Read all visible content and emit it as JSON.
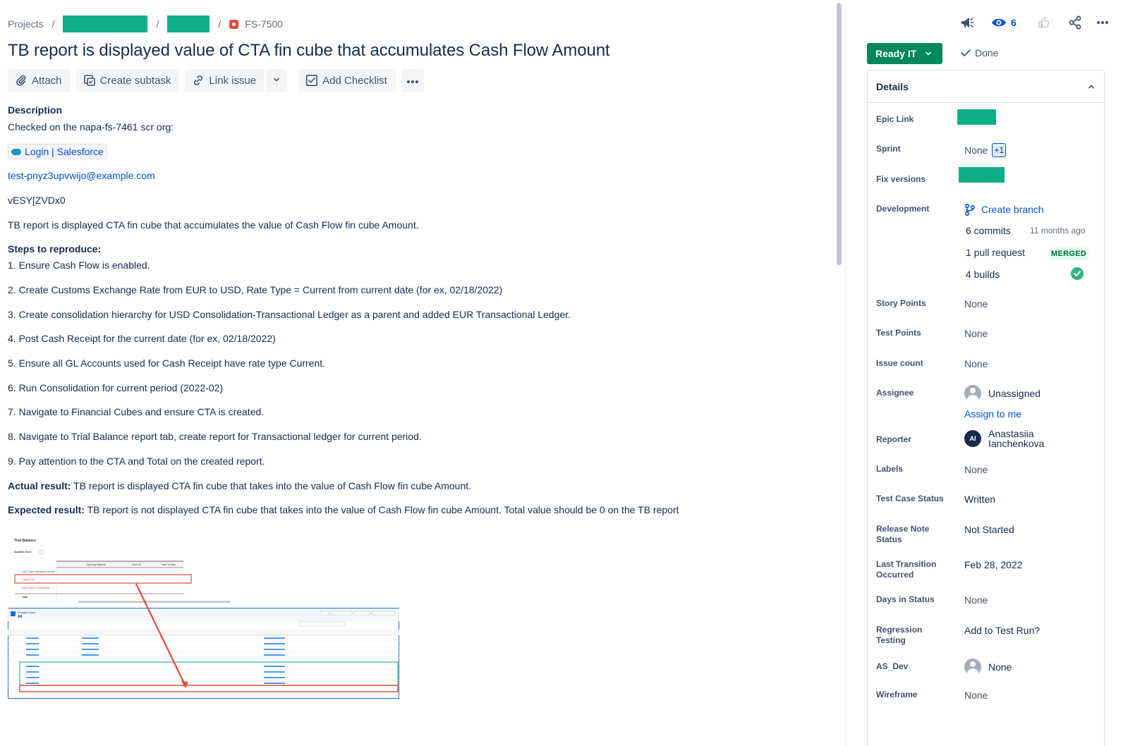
{
  "breadcrumb": {
    "projects": "Projects",
    "sep": "/",
    "issue_key": "FS-7500"
  },
  "issue": {
    "title": "TB report is displayed value of CTA fin cube that accumulates Cash Flow Amount"
  },
  "toolbar": {
    "attach": "Attach",
    "create_subtask": "Create subtask",
    "link_issue": "Link issue",
    "add_checklist": "Add Checklist"
  },
  "description": {
    "heading": "Description",
    "checked_on": "Checked on the napa-fs-7461 scr org:",
    "login_link": "Login | Salesforce",
    "email": "test-pnyz3upvwijo@example.com",
    "password": "vESY[ZVDx0",
    "summary": "TB report is displayed CTA fin cube that accumulates the value of Cash Flow fin cube Amount.",
    "steps_heading": "Steps to reproduce:",
    "steps": [
      "1.  Ensure Cash Flow is enabled.",
      "2. Create Customs Exchange Rate from EUR to USD, Rate Type = Current from current date (for ex, 02/18/2022)",
      "3.  Create consolidation hierarchy for USD Consolidation-Transactional Ledger as a parent and added EUR Transactional Ledger.",
      "4.  Post Cash Receipt for the current date (for ex, 02/18/2022)",
      "5. Ensure all GL Accounts used for Cash Receipt have rate type Current.",
      "6. Run Consolidation for current period (2022-02)",
      "7. Navigate to Financial Cubes and ensure CTA is created.",
      "8. Navigate to Trial Balance report tab, create report for Transactional ledger for current period.",
      "9. Pay attention to the CTA and Total on the created report."
    ],
    "actual_label": "Actual result:",
    "actual_text": " TB report is displayed CTA fin cube that takes into the value of Cash Flow fin cube Amount.",
    "expected_label": "Expected result:",
    "expected_text": " TB report is not displayed CTA fin cube that takes into the value of Cash Flow fin cube Amount. Total value should be 0 on the TB report"
  },
  "attachment": {
    "report_title": "Trial Balance",
    "report_subtitle": "Subtitle Here",
    "col_opening": "Opening Balance",
    "col_period": "2022-02",
    "col_ytd": "Year To Date",
    "row1": "1001-Cash Operating Account",
    "row2": "Global CTA",
    "row3": "5000-Cost of Goods Sold",
    "row_total": "Total",
    "cubes_title": "Financial Cubes",
    "cubes_view": "All"
  },
  "header_actions": {
    "watchers": "6"
  },
  "status": {
    "label": "Ready IT",
    "done": "Done"
  },
  "details": {
    "heading": "Details",
    "epic_link": "Epic Link",
    "sprint": "Sprint",
    "sprint_value": "None",
    "sprint_extra": "+1",
    "fix_versions": "Fix versions",
    "development": "Development",
    "create_branch": "Create branch",
    "commits": "6 commits",
    "commits_time": "11 months ago",
    "pull_request": "1 pull request",
    "merged": "MERGED",
    "builds": "4 builds",
    "story_points": "Story Points",
    "story_points_value": "None",
    "test_points": "Test Points",
    "test_points_value": "None",
    "issue_count": "Issue count",
    "issue_count_value": "None",
    "assignee": "Assignee",
    "assignee_value": "Unassigned",
    "assign_to_me": "Assign to me",
    "reporter": "Reporter",
    "reporter_initials": "AI",
    "reporter_first": "Anastasiia",
    "reporter_last": "Ianchenkova",
    "labels": "Labels",
    "labels_value": "None",
    "test_case_status": "Test Case Status",
    "test_case_status_value": "Written",
    "release_note_status_1": "Release Note",
    "release_note_status_2": "Status",
    "release_note_status_value": "Not Started",
    "last_transition_1": "Last Transition",
    "last_transition_2": "Occurred",
    "last_transition_value": "Feb 28, 2022",
    "days_in_status": "Days in Status",
    "days_in_status_value": "None",
    "regression_1": "Regression",
    "regression_2": "Testing",
    "regression_value": "Add to Test Run?",
    "as_dev": "AS_Dev",
    "as_dev_value": "None",
    "wireframe": "Wireframe",
    "wireframe_value": "None"
  },
  "colors": {
    "brand_green": "#00875A",
    "redaction": "#0FAF8A",
    "link_blue": "#0052CC",
    "bug_red": "#E5493A"
  }
}
